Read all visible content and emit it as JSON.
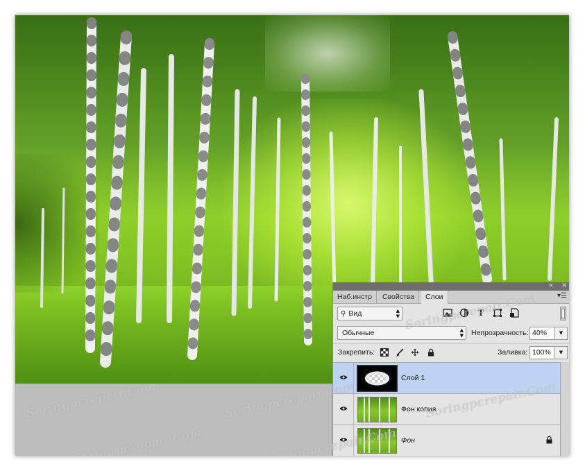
{
  "panel": {
    "tabs": [
      {
        "label": "Наб.инстр"
      },
      {
        "label": "Свойства"
      },
      {
        "label": "Слои",
        "active": true
      }
    ],
    "collapse_icon": "double-chevron-icon",
    "close_icon": "close-icon",
    "menu_icon": "panel-menu-icon",
    "filter": {
      "search_icon": "search-icon",
      "kind_label": "Вид"
    },
    "filter_icons": [
      "image-filter-icon",
      "adjustment-filter-icon",
      "type-filter-icon",
      "shape-filter-icon",
      "smart-object-filter-icon"
    ],
    "blend_mode": "Обычные",
    "opacity_label": "Непрозрачность:",
    "opacity_value": "40%",
    "lock_label": "Закрепить:",
    "lock_icons": [
      "lock-pixels-icon",
      "lock-paint-icon",
      "lock-position-icon",
      "lock-all-icon"
    ],
    "fill_label": "Заливка:",
    "fill_value": "100%",
    "layers": [
      {
        "name": "Слой 1",
        "selected": true,
        "visible": true,
        "thumb": "vignette-mask",
        "locked": false
      },
      {
        "name": "Фон копия",
        "selected": false,
        "visible": true,
        "thumb": "forest",
        "locked": false
      },
      {
        "name": "Фон",
        "selected": false,
        "visible": true,
        "thumb": "forest",
        "locked": true,
        "italic": true
      }
    ]
  },
  "canvas": {
    "image": "birch-forest-photo"
  },
  "watermark": "Soringpcrepair.Com",
  "colors": {
    "selection": "#bed3f4",
    "panel_bg": "#e4e4e4",
    "canvas_bg": "#bcbcbc"
  }
}
